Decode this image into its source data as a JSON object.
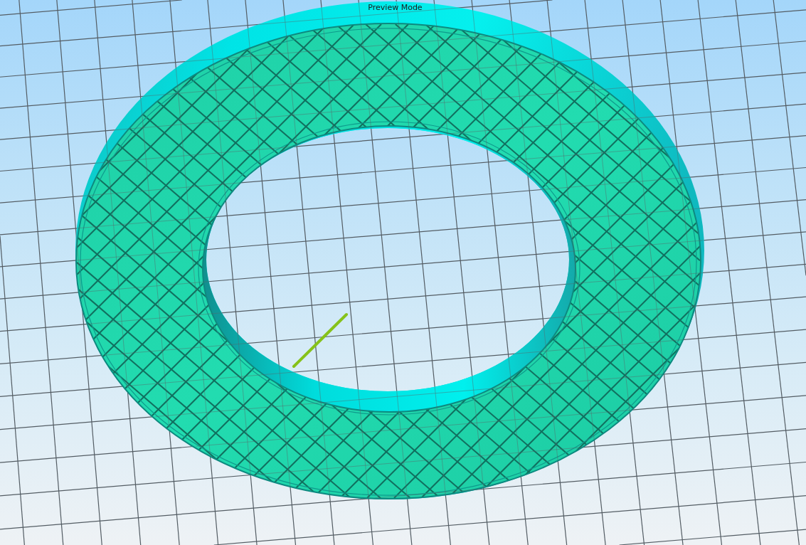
{
  "viewport": {
    "mode_label": "Preview Mode"
  }
}
